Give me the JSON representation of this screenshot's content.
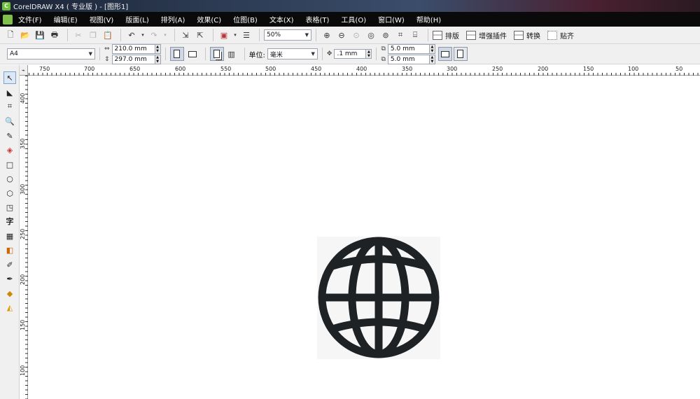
{
  "window": {
    "title": "CorelDRAW X4 ( 专业版 ) - [图形1]",
    "app_icon": "coreldraw-icon"
  },
  "menu": [
    "文件(F)",
    "编辑(E)",
    "视图(V)",
    "版面(L)",
    "排列(A)",
    "效果(C)",
    "位图(B)",
    "文本(X)",
    "表格(T)",
    "工具(O)",
    "窗口(W)",
    "帮助(H)"
  ],
  "toolbar1": {
    "zoom": "50%",
    "buttons": [
      {
        "label": "排版",
        "icon": "layout-icon"
      },
      {
        "label": "增强插件",
        "icon": "plugin-icon"
      },
      {
        "label": "转换",
        "icon": "convert-icon"
      },
      {
        "label": "贴齐",
        "icon": "snap-icon"
      }
    ]
  },
  "property_bar": {
    "page_size": "A4",
    "width": "210.0 mm",
    "height": "297.0 mm",
    "units_label": "单位:",
    "units": "毫米",
    "nudge": ".1 mm",
    "dup_x": "5.0 mm",
    "dup_y": "5.0 mm"
  },
  "ruler": {
    "h_labels": [
      "750",
      "700",
      "650",
      "600",
      "550",
      "500",
      "450",
      "400",
      "350",
      "300",
      "250",
      "200",
      "150",
      "100",
      "50"
    ],
    "v_labels": [
      "400",
      "350",
      "300",
      "250",
      "200",
      "150",
      "100"
    ],
    "corner": "⌁"
  },
  "colors": {
    "menubar": "#0a0a0a",
    "globe": "#1e2224",
    "toolbar": "#f0f0f0"
  }
}
